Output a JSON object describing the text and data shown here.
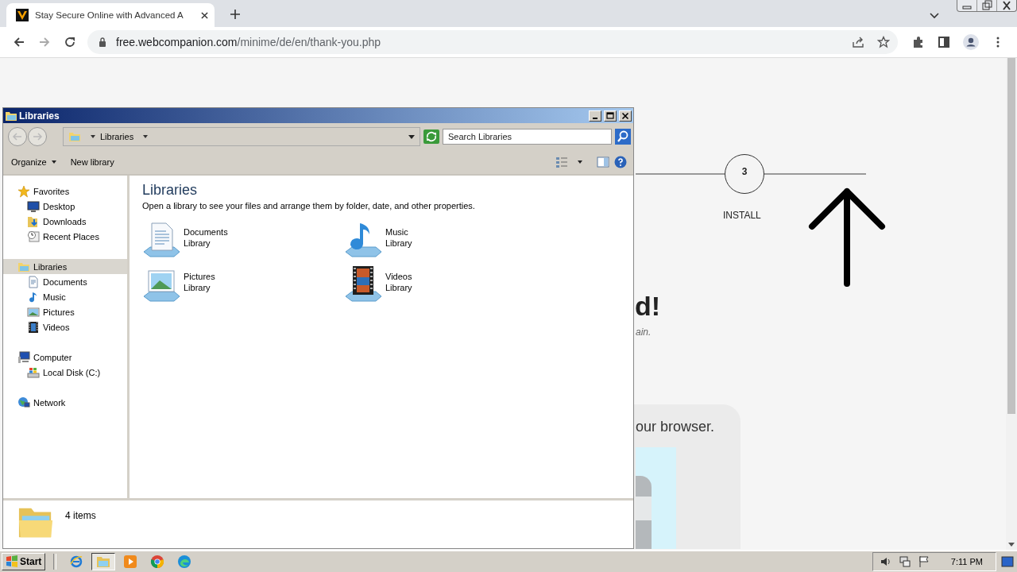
{
  "browser": {
    "tab": {
      "title": "Stay Secure Online with Advanced A",
      "selected": true
    },
    "url_host": "free.webcompanion.com",
    "url_path": "/minime/de/en/thank-you.php"
  },
  "page": {
    "step_number": "3",
    "step_label": "INSTALL",
    "heading_fragment": "d!",
    "subtitle_fragment": "ain.",
    "card_text_fragment": "our browser."
  },
  "explorer": {
    "title": "Libraries",
    "breadcrumb": "Libraries",
    "search": {
      "placeholder": "Search Libraries"
    },
    "toolbar": [
      {
        "label": "Organize",
        "dropdown": true
      },
      {
        "label": "New library",
        "dropdown": false
      }
    ],
    "nav": [
      {
        "label": "Favorites",
        "kind": "star",
        "selected": false,
        "children": [
          {
            "label": "Desktop",
            "kind": "desktop",
            "selected": false
          },
          {
            "label": "Downloads",
            "kind": "downloads",
            "selected": false
          },
          {
            "label": "Recent Places",
            "kind": "recent",
            "selected": false
          }
        ]
      },
      {
        "label": "Libraries",
        "kind": "library",
        "selected": true,
        "children": [
          {
            "label": "Documents",
            "kind": "document",
            "selected": false
          },
          {
            "label": "Music",
            "kind": "music",
            "selected": false
          },
          {
            "label": "Pictures",
            "kind": "picture",
            "selected": false
          },
          {
            "label": "Videos",
            "kind": "video",
            "selected": false
          }
        ]
      },
      {
        "label": "Computer",
        "kind": "computer",
        "selected": false,
        "children": [
          {
            "label": "Local Disk (C:)",
            "kind": "disk",
            "selected": false
          }
        ]
      },
      {
        "label": "Network",
        "kind": "network",
        "selected": false
      }
    ],
    "heading": "Libraries",
    "description": "Open a library to see your files and arrange them by folder, date, and other properties.",
    "items": [
      {
        "name": "Documents",
        "type": "Library",
        "kind": "document"
      },
      {
        "name": "Music",
        "type": "Library",
        "kind": "music"
      },
      {
        "name": "Pictures",
        "type": "Library",
        "kind": "picture"
      },
      {
        "name": "Videos",
        "type": "Library",
        "kind": "video"
      }
    ],
    "status": "4 items"
  },
  "taskbar": {
    "start": "Start",
    "apps": [
      {
        "kind": "ie",
        "selected": false
      },
      {
        "kind": "explorer",
        "selected": true
      },
      {
        "kind": "media",
        "selected": false
      },
      {
        "kind": "chrome",
        "selected": false
      },
      {
        "kind": "edge",
        "selected": false
      }
    ],
    "clock": "7:11 PM"
  }
}
